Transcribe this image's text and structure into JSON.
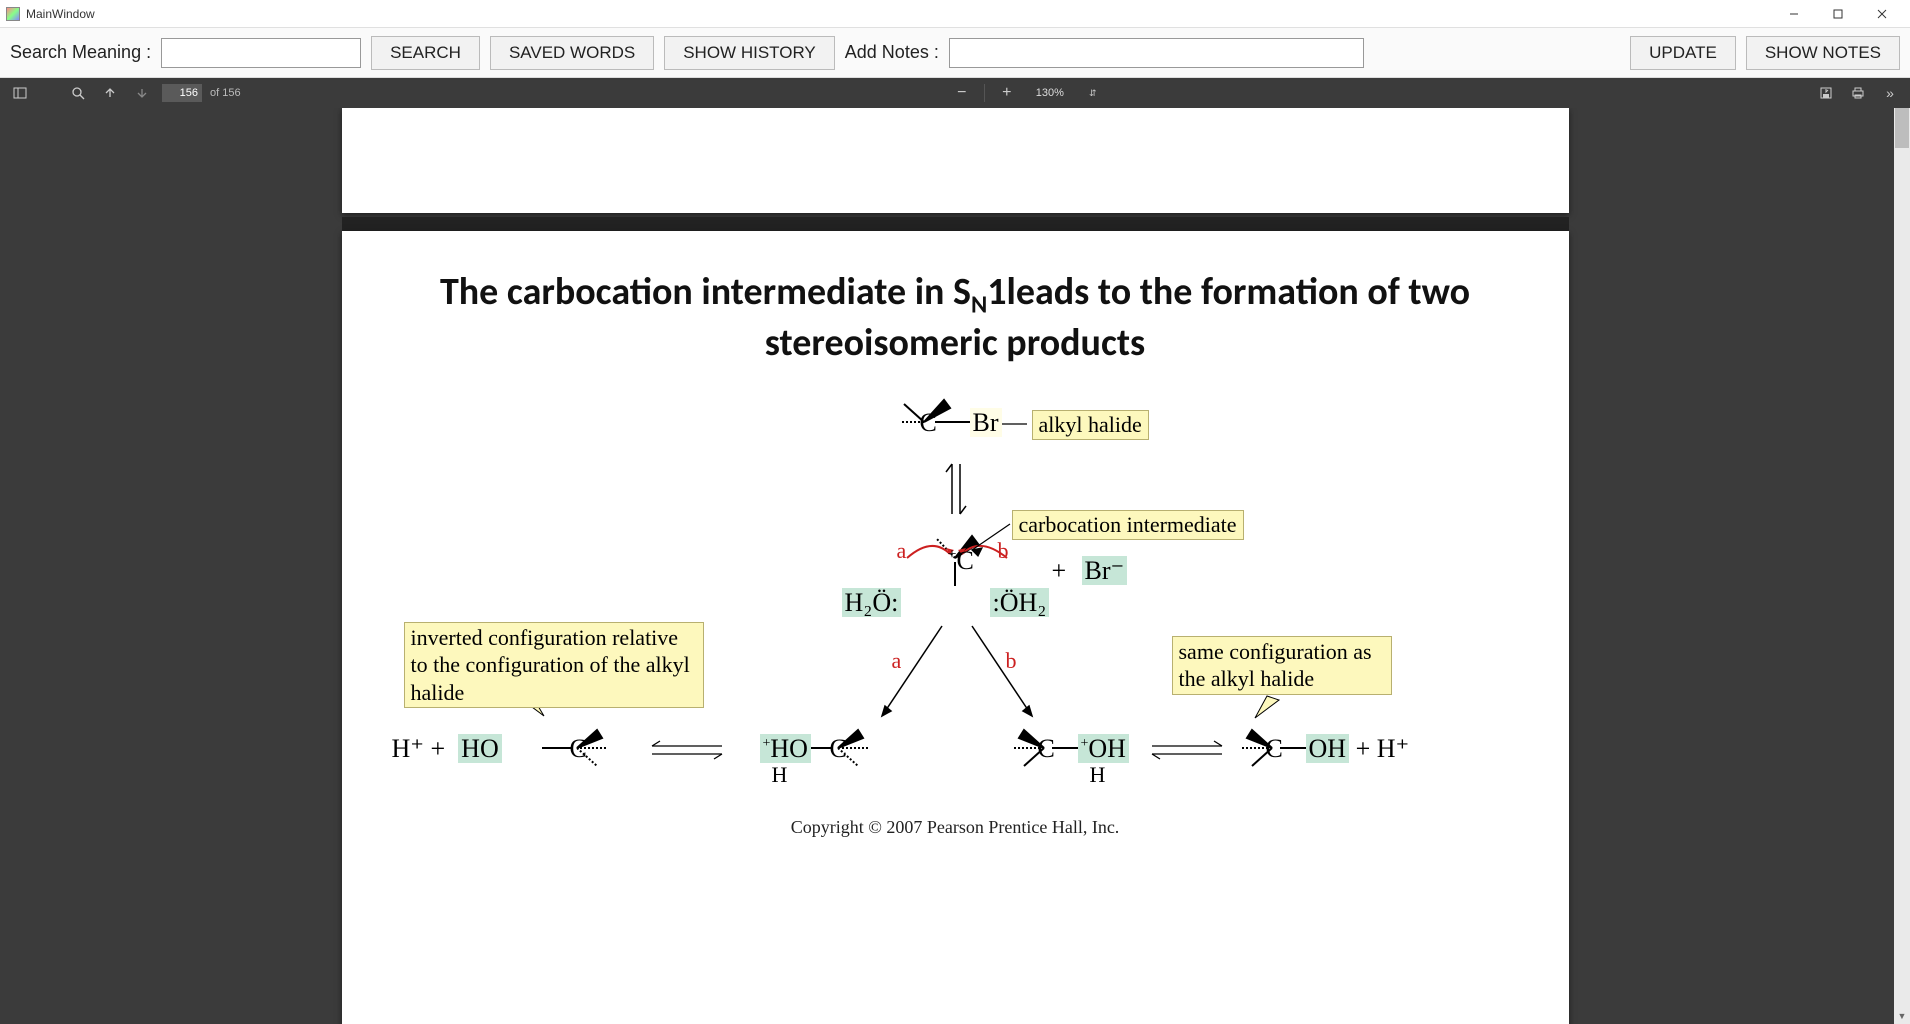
{
  "window": {
    "title": "MainWindow"
  },
  "toolbar": {
    "search_label": "Search Meaning :",
    "search_value": "",
    "search_btn": "SEARCH",
    "saved_words_btn": "SAVED WORDS",
    "show_history_btn": "SHOW HISTORY",
    "add_notes_label": "Add Notes :",
    "notes_value": "",
    "update_btn": "UPDATE",
    "show_notes_btn": "SHOW NOTES"
  },
  "pdf": {
    "page_current": "156",
    "page_total": "of 156",
    "zoom": "130%"
  },
  "slide": {
    "title_pre": "The carbocation intermediate in S",
    "title_sub": "N",
    "title_post": "1leads to the formation of  two stereoisomeric products",
    "label_alkyl_halide": "alkyl halide",
    "label_carbocation": "carbocation intermediate",
    "label_inverted": "inverted configuration relative to the configuration of the alkyl halide",
    "label_same": "same configuration as the alkyl halide",
    "path_a": "a",
    "path_b": "b",
    "c": "C",
    "br": "Br",
    "br_minus": "Br⁻",
    "plus": "+",
    "h2o_left": "H₂Ö:",
    "h2o_right": ":ÖH₂",
    "ho": "HO",
    "oh": "OH",
    "h_plus": "H⁺",
    "h": "H",
    "copyright": "Copyright © 2007 Pearson Prentice Hall, Inc."
  }
}
